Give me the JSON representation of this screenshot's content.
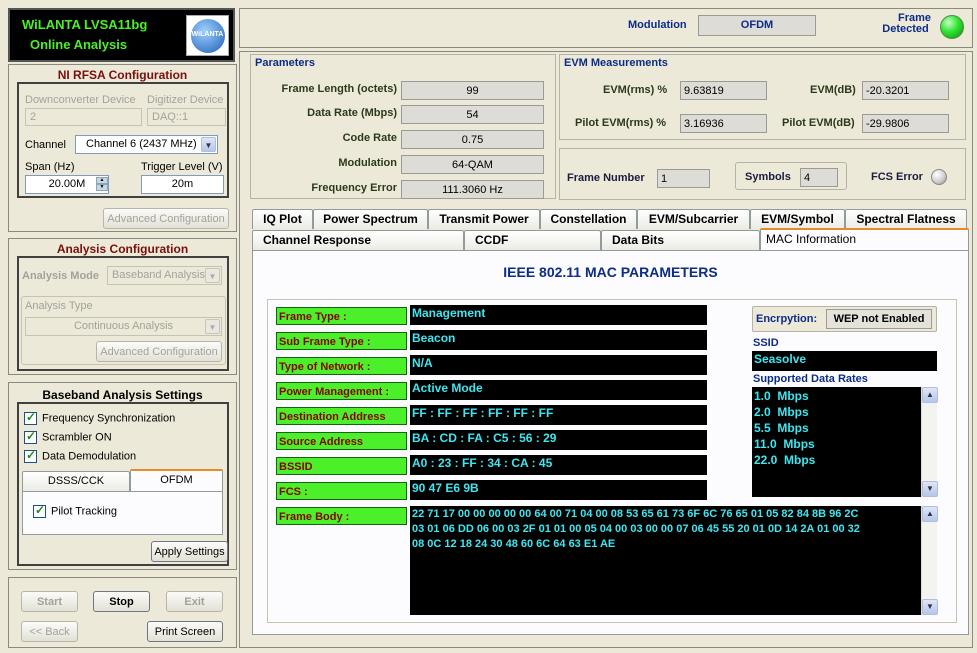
{
  "app": {
    "title_line1": "WiLANTA LVSA11bg",
    "title_line2": "Online Analysis",
    "logo_text": "WiLANTA"
  },
  "status": {
    "modulation_label": "Modulation",
    "modulation_value": "OFDM",
    "frame_detected_label_1": "Frame",
    "frame_detected_label_2": "Detected",
    "led_color": "#2ee52e"
  },
  "rfsa": {
    "title": "NI RFSA Configuration",
    "downconverter_label": "Downconverter Device",
    "downconverter_value": "2",
    "digitizer_label": "Digitizer Device",
    "digitizer_value": "DAQ::1",
    "channel_label": "Channel",
    "channel_value": "Channel 6 (2437 MHz)",
    "span_label": "Span (Hz)",
    "span_value": "20.00M",
    "trigger_label": "Trigger Level (V)",
    "trigger_value": "20m",
    "advanced_button": "Advanced Configuration"
  },
  "analysis": {
    "title": "Analysis Configuration",
    "mode_label": "Analysis Mode",
    "mode_value": "Baseband Analysis",
    "type_label": "Analysis Type",
    "type_value": "Continuous Analysis",
    "advanced_button": "Advanced Configuration"
  },
  "baseband": {
    "title": "Baseband Analysis Settings",
    "freq_sync": "Frequency Synchronization",
    "scrambler": "Scrambler ON",
    "demod": "Data Demodulation",
    "tab_dsss": "DSSS/CCK",
    "tab_ofdm": "OFDM",
    "pilot_tracking": "Pilot Tracking",
    "apply_button": "Apply Settings"
  },
  "controls": {
    "start": "Start",
    "stop": "Stop",
    "exit": "Exit",
    "back": "<< Back",
    "print": "Print Screen"
  },
  "parameters": {
    "title": "Parameters",
    "rows": [
      {
        "label": "Frame Length (octets)",
        "value": "99"
      },
      {
        "label": "Data Rate (Mbps)",
        "value": "54"
      },
      {
        "label": "Code Rate",
        "value": "0.75"
      },
      {
        "label": "Modulation",
        "value": "64-QAM"
      },
      {
        "label": "Frequency Error",
        "value": "111.3060 Hz"
      }
    ]
  },
  "evm": {
    "title": "EVM Measurements",
    "evm_rms_label": "EVM(rms) %",
    "evm_rms_value": "9.63819",
    "evm_db_label": "EVM(dB)",
    "evm_db_value": "-20.3201",
    "pilot_rms_label": "Pilot EVM(rms) %",
    "pilot_rms_value": "3.16936",
    "pilot_db_label": "Pilot EVM(dB)",
    "pilot_db_value": "-29.9806"
  },
  "frame": {
    "frame_number_label": "Frame Number",
    "frame_number_value": "1",
    "symbols_label": "Symbols",
    "symbols_value": "4",
    "fcs_error_label": "FCS Error"
  },
  "tabs_row1": [
    "IQ Plot",
    "Power Spectrum",
    "Transmit Power",
    "Constellation",
    "EVM/Subcarrier",
    "EVM/Symbol",
    "Spectral Flatness"
  ],
  "tabs_row2": [
    "Channel Response",
    "CCDF",
    "Data Bits",
    "MAC Information"
  ],
  "mac": {
    "heading": "IEEE 802.11 MAC PARAMETERS",
    "fields": [
      {
        "label": "Frame Type :",
        "value": "Management"
      },
      {
        "label": "Sub Frame Type :",
        "value": "Beacon"
      },
      {
        "label": "Type of Network :",
        "value": "N/A"
      },
      {
        "label": "Power Management :",
        "value": "Active Mode"
      },
      {
        "label": "Destination Address",
        "value": "FF : FF : FF : FF : FF : FF"
      },
      {
        "label": "Source Address",
        "value": "BA : CD : FA : C5 : 56 : 29"
      },
      {
        "label": "BSSID",
        "value": "A0 : 23 : FF : 34 : CA : 45"
      },
      {
        "label": "FCS :",
        "value": "90 47 E6 9B"
      }
    ],
    "frame_body_label": "Frame Body :",
    "frame_body_lines": [
      "22 71 17 00 00 00 00 00 64 00 71 04 00 08 53 65 61 73 6F 6C 76 65 01 05 82 84 8B 96 2C",
      "03 01 06 DD 06 00 03 2F 01 01 00 05 04 00 03 00 00 07 06 45 55 20 01 0D 14 2A 01 00 32",
      "08 0C 12 18 24 30 48 60 6C 64 63 E1 AE"
    ],
    "encryption_label": "Encrpytion:",
    "encryption_value": "WEP not Enabled",
    "ssid_label": "SSID",
    "ssid_value": "Seasolve",
    "rates_label": "Supported Data Rates",
    "rates": [
      "1.0  Mbps",
      "2.0  Mbps",
      "5.5  Mbps",
      "11.0  Mbps",
      "22.0  Mbps"
    ]
  }
}
